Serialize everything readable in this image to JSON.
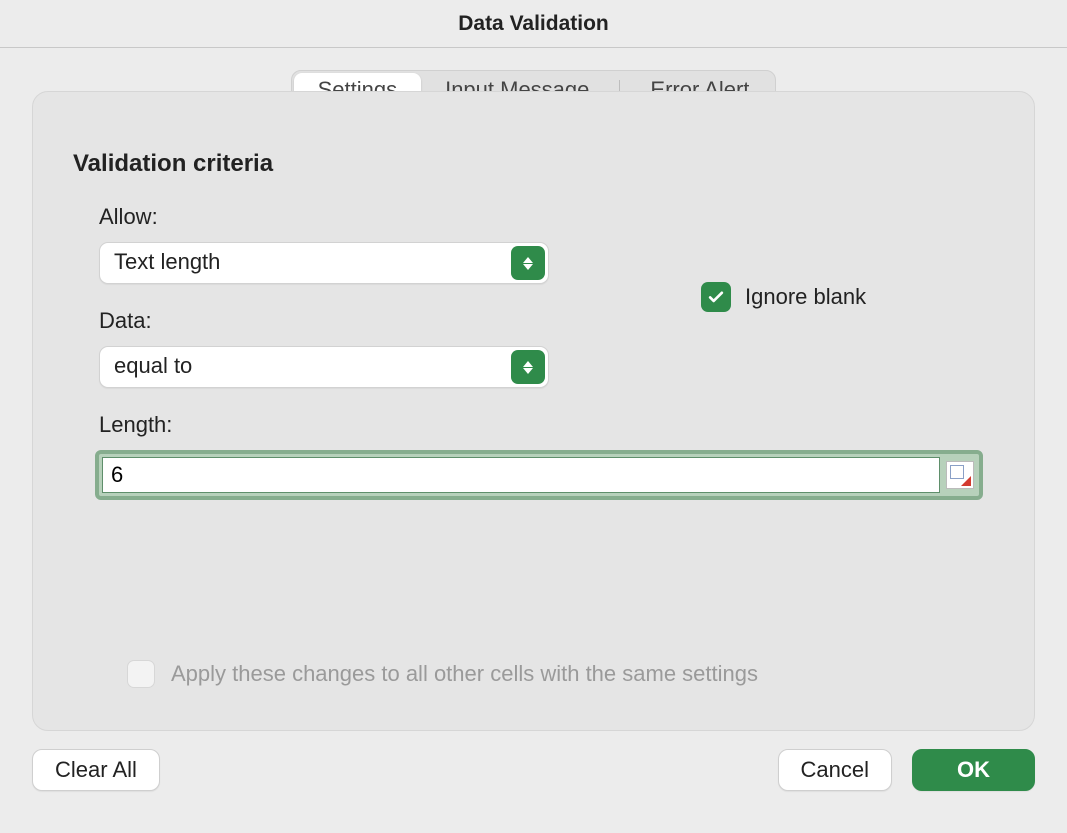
{
  "title": "Data Validation",
  "tabs": {
    "settings": "Settings",
    "input_message": "Input Message",
    "error_alert": "Error Alert",
    "active": "settings"
  },
  "section_heading": "Validation criteria",
  "labels": {
    "allow": "Allow:",
    "data": "Data:",
    "length": "Length:"
  },
  "allow": {
    "value": "Text length"
  },
  "data": {
    "value": "equal to"
  },
  "length_value": "6",
  "ignore_blank": {
    "label": "Ignore blank",
    "checked": true
  },
  "apply_all": {
    "label": "Apply these changes to all other cells with the same settings",
    "checked": false,
    "enabled": false
  },
  "buttons": {
    "clear_all": "Clear All",
    "cancel": "Cancel",
    "ok": "OK"
  },
  "colors": {
    "accent": "#2f8b4a"
  }
}
